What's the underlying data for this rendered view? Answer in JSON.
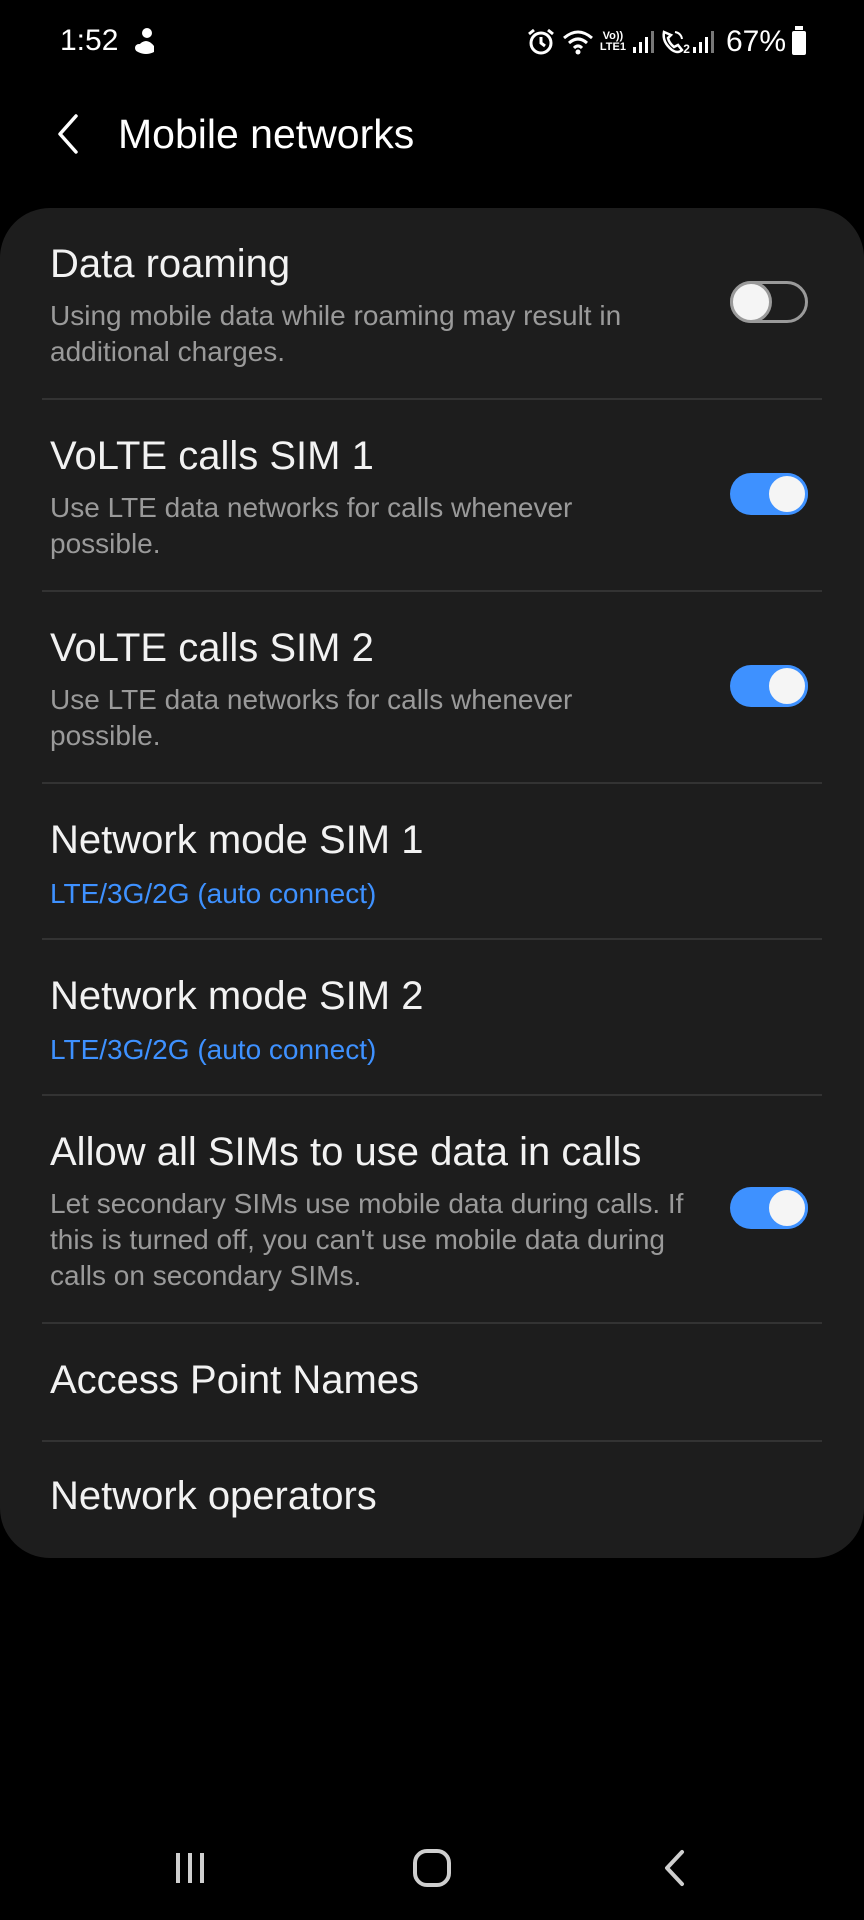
{
  "status_bar": {
    "time": "1:52",
    "battery": "67%",
    "sim_label": "LTE1",
    "sim2_label": "2",
    "volte_label": "Vo))",
    "icons": [
      "notification-icon",
      "alarm-icon",
      "wifi-icon",
      "signal-icon",
      "call-icon",
      "battery-icon"
    ]
  },
  "header": {
    "title": "Mobile networks",
    "back_icon": "back-arrow-icon"
  },
  "settings": [
    {
      "title": "Data roaming",
      "subtitle": "Using mobile data while roaming may result in additional charges.",
      "toggle": false
    },
    {
      "title": "VoLTE calls SIM 1",
      "subtitle": "Use LTE data networks for calls whenever possible.",
      "toggle": true
    },
    {
      "title": "VoLTE calls SIM 2",
      "subtitle": "Use LTE data networks for calls whenever possible.",
      "toggle": true
    },
    {
      "title": "Network mode SIM 1",
      "value": "LTE/3G/2G (auto connect)"
    },
    {
      "title": "Network mode SIM 2",
      "value": "LTE/3G/2G (auto connect)"
    },
    {
      "title": "Allow all SIMs to use data in calls",
      "subtitle": "Let secondary SIMs use mobile data during calls. If this is turned off, you can't use mobile data during calls on secondary SIMs.",
      "toggle": true
    },
    {
      "title": "Access Point Names"
    },
    {
      "title": "Network operators"
    }
  ],
  "colors": {
    "accent": "#3e91ff",
    "background": "#000000",
    "card": "#1d1d1d",
    "subtitle": "#9a9a9a"
  },
  "nav_bar": {
    "icons": [
      "recent-apps-icon",
      "home-icon",
      "back-icon"
    ]
  }
}
